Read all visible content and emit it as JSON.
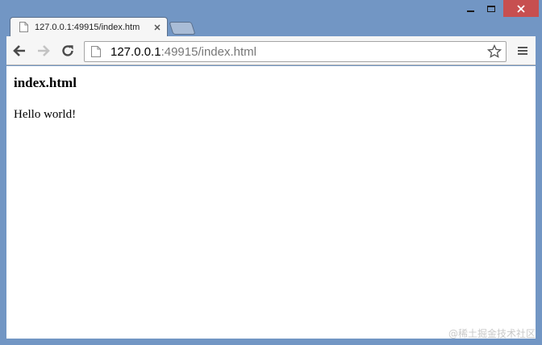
{
  "window": {
    "colors": {
      "frame": "#7296c4",
      "close_button": "#c74f50",
      "toolbar": "#f6f6f6"
    }
  },
  "tab": {
    "title": "127.0.0.1:49915/index.htm",
    "icons": {
      "page": "page-icon",
      "close": "close-icon"
    }
  },
  "toolbar": {
    "url_host": "127.0.0.1",
    "url_rest": ":49915/index.html",
    "icons": {
      "back": "back-arrow-icon",
      "forward": "forward-arrow-icon",
      "reload": "reload-icon",
      "star": "star-icon",
      "menu": "hamburger-menu-icon"
    }
  },
  "page": {
    "heading": "index.html",
    "body_text": "Hello world!"
  },
  "watermark": "@稀土掘金技术社区"
}
